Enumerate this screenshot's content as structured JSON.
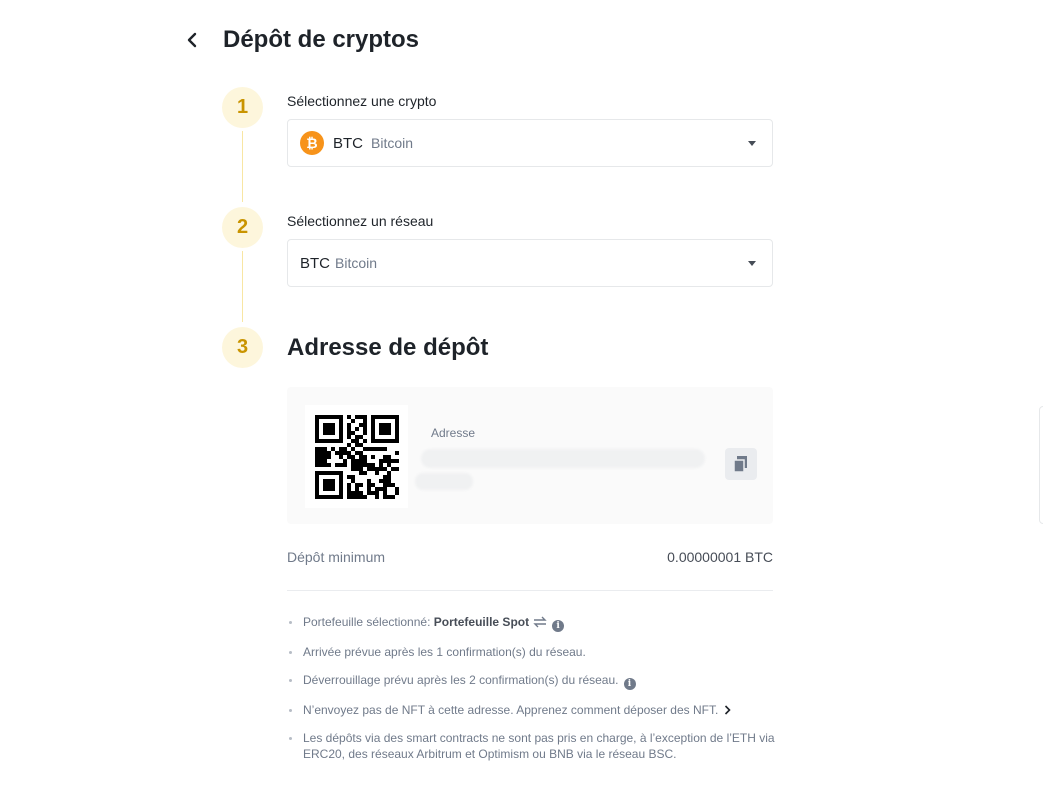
{
  "header": {
    "title": "Dépôt de cryptos"
  },
  "steps": [
    {
      "number": "1",
      "label": "Sélectionnez une crypto"
    },
    {
      "number": "2",
      "label": "Sélectionnez un réseau"
    },
    {
      "number": "3",
      "label": "Adresse de dépôt"
    }
  ],
  "coin_select": {
    "icon_glyph": "₿",
    "symbol": "BTC",
    "name": "Bitcoin",
    "icon_color": "#f7931a"
  },
  "network_select": {
    "symbol": "BTC",
    "name": "Bitcoin"
  },
  "address": {
    "label": "Adresse"
  },
  "min_deposit": {
    "label": "Dépôt minimum",
    "value": "0.00000001 BTC"
  },
  "notes": {
    "wallet_prefix": "Portefeuille sélectionné: ",
    "wallet_name": "Portefeuille Spot",
    "arrival": "Arrivée prévue après les 1 confirmation(s) du réseau.",
    "unlock": "Déverrouillage prévu après les 2 confirmation(s) du réseau.",
    "nft": "N’envoyez pas de NFT à cette adresse. Apprenez comment déposer des NFT.",
    "smart_contracts": "Les dépôts via des smart contracts ne sont pas pris en charge, à l’exception de l’ETH via ERC20, des réseaux Arbitrum et Optimism ou BNB via le réseau BSC.",
    "info_glyph": "i"
  },
  "colors": {
    "accent": "#c99400",
    "step_bg": "#fdf6dc",
    "text": "#1e2329",
    "muted": "#707a8a"
  }
}
